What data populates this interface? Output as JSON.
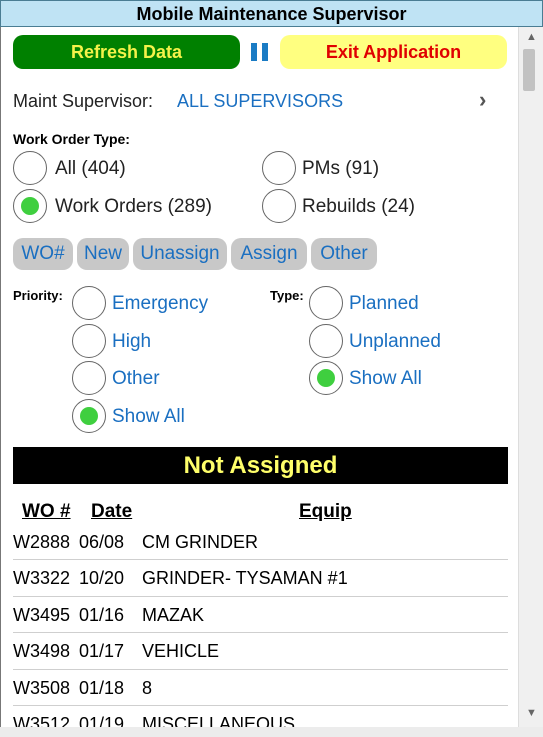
{
  "window": {
    "title": "Mobile Maintenance Supervisor"
  },
  "toolbar": {
    "refresh_label": "Refresh Data",
    "exit_label": "Exit Application",
    "pause_icon": "pause-icon"
  },
  "supervisor": {
    "label": "Maint Supervisor:",
    "value": "ALL SUPERVISORS"
  },
  "work_order_type": {
    "title": "Work Order Type:",
    "options": [
      {
        "label": "All (404)",
        "selected": false
      },
      {
        "label": "PMs (91)",
        "selected": false
      },
      {
        "label": "Work Orders (289)",
        "selected": true
      },
      {
        "label": "Rebuilds (24)",
        "selected": false
      }
    ]
  },
  "tabs": [
    "WO#",
    "New",
    "Unassign",
    "Assign",
    "Other"
  ],
  "priority": {
    "title": "Priority:",
    "options": [
      {
        "label": "Emergency",
        "selected": false
      },
      {
        "label": "High",
        "selected": false
      },
      {
        "label": "Other",
        "selected": false
      },
      {
        "label": "Show All",
        "selected": true
      }
    ]
  },
  "type_filter": {
    "title": "Type:",
    "options": [
      {
        "label": "Planned",
        "selected": false
      },
      {
        "label": "Unplanned",
        "selected": false
      },
      {
        "label": "Show All",
        "selected": true
      }
    ]
  },
  "section": {
    "banner": "Not Assigned"
  },
  "table": {
    "headers": [
      "WO #",
      "Date",
      "Equip"
    ],
    "rows": [
      [
        "W2888",
        "06/08",
        "CM GRINDER"
      ],
      [
        "W3322",
        "10/20",
        "GRINDER- TYSAMAN #1"
      ],
      [
        "W3495",
        "01/16",
        "MAZAK"
      ],
      [
        "W3498",
        "01/17",
        "VEHICLE"
      ],
      [
        "W3508",
        "01/18",
        "8"
      ],
      [
        "W3512",
        "01/19",
        "MISCELLANEOUS"
      ]
    ]
  },
  "colors": {
    "accent": "#1a6fc1",
    "refresh_bg": "#008000",
    "exit_bg": "#ffff80",
    "exit_text": "#e00000",
    "selected_radio": "#3fcf3f",
    "banner_bg": "#000000",
    "banner_text": "#ffff6a"
  }
}
